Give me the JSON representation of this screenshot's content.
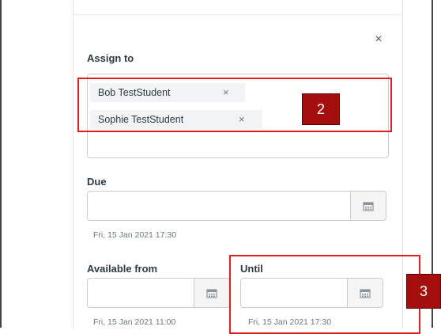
{
  "dialog": {
    "close_glyph": "×",
    "assign_to": {
      "label": "Assign to",
      "pills": [
        {
          "name": "Bob TestStudent",
          "remove": "×"
        },
        {
          "name": "Sophie TestStudent",
          "remove": "×"
        }
      ]
    },
    "due": {
      "label": "Due",
      "value": "",
      "hint": "Fri, 15 Jan 2021 17:30"
    },
    "available_from": {
      "label": "Available from",
      "value": "",
      "hint": "Fri, 15 Jan 2021 11:00"
    },
    "until": {
      "label": "Until",
      "value": "",
      "hint": "Fri, 15 Jan 2021 17:30"
    }
  },
  "annotations": {
    "badge_2": "2",
    "badge_3": "3",
    "color": "#e02020",
    "badge_color": "#a50e0e"
  },
  "icons": {
    "close": "close-icon",
    "calendar": "calendar-icon"
  }
}
